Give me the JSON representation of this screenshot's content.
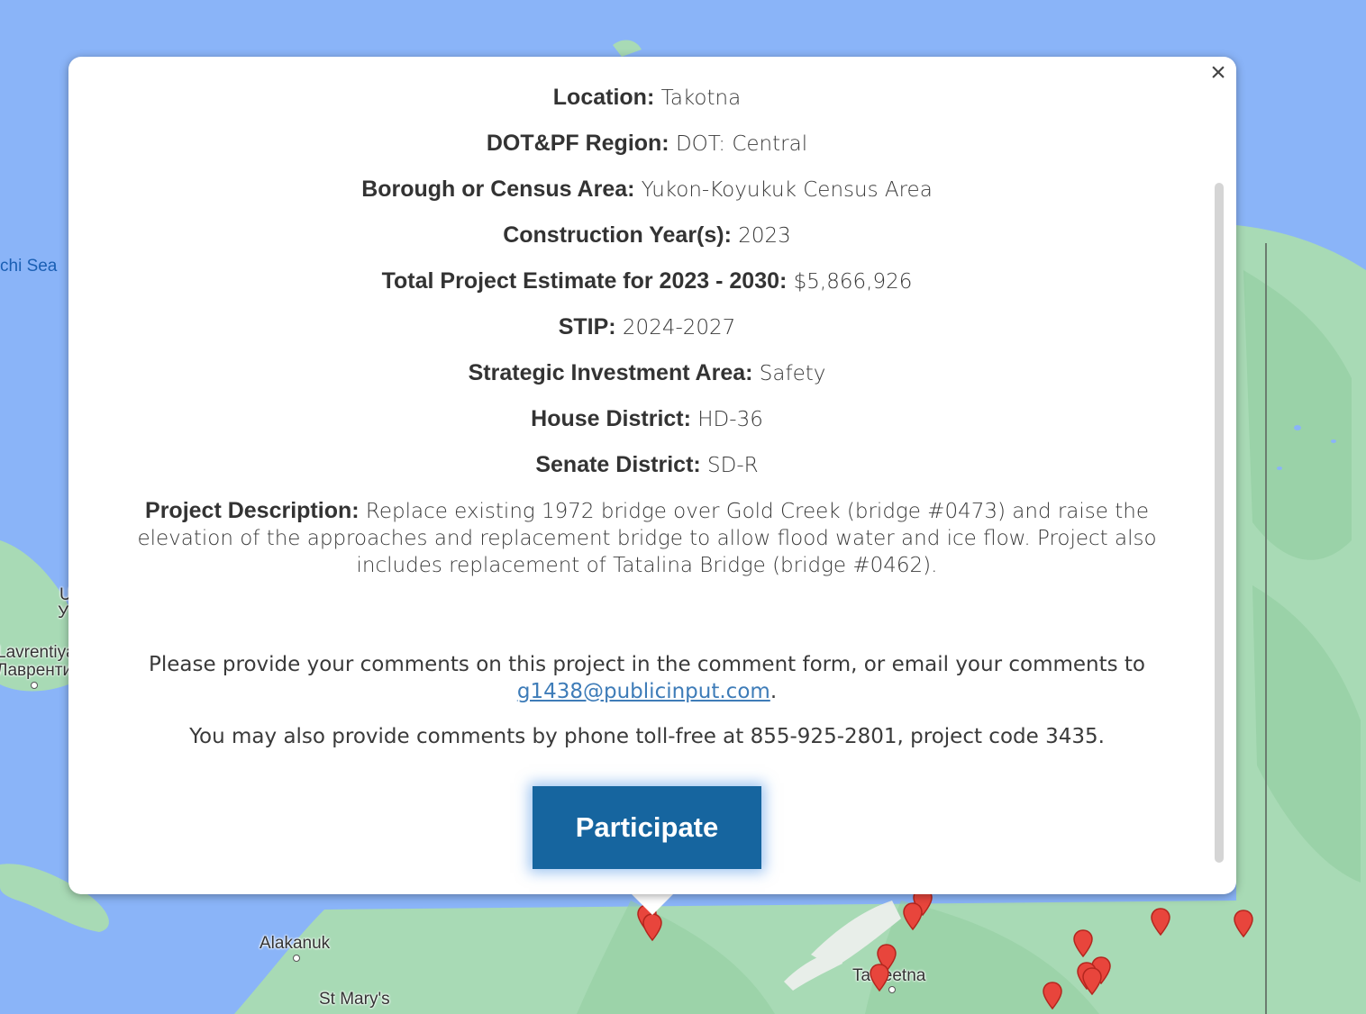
{
  "map": {
    "labels": {
      "sea": "chi Sea",
      "lavrentiya": "Lavrentiya",
      "lavrentiya_cyr": "Лаврентия",
      "partial_u": "U",
      "partial_y": "У",
      "alakanuk": "Alakanuk",
      "st_marys": "St Mary's",
      "talkeetna": "Talkeetna"
    },
    "colors": {
      "water": "#8ab4f8",
      "land": "#a8dab5",
      "pin": "#e8453c"
    }
  },
  "popup": {
    "close_icon": "×",
    "fields": [
      {
        "label": "Location:",
        "value": "Takotna"
      },
      {
        "label": "DOT&PF Region:",
        "value": "DOT: Central"
      },
      {
        "label": "Borough or Census Area:",
        "value": "Yukon-Koyukuk Census Area"
      },
      {
        "label": "Construction Year(s):",
        "value": "2023"
      },
      {
        "label": "Total Project Estimate for 2023 - 2030:",
        "value": "$5,866,926"
      },
      {
        "label": "STIP:",
        "value": "2024-2027"
      },
      {
        "label": "Strategic Investment Area:",
        "value": "Safety"
      },
      {
        "label": "House District:",
        "value": "HD-36"
      },
      {
        "label": "Senate District:",
        "value": "SD-R"
      }
    ],
    "description": {
      "label": "Project Description:",
      "value": "Replace existing 1972 bridge over Gold Creek (bridge #0473) and raise the elevation of the approaches and replacement bridge to allow flood water and ice flow. Project also includes replacement of Tatalina Bridge (bridge #0462)."
    },
    "comment_text": "Please provide your comments on this project in the comment form, or email your comments to",
    "email": "g1438@publicinput.com",
    "comment_period": ".",
    "phone_text": "You may also provide comments by phone toll-free at 855-925-2801, project code 3435.",
    "participate_label": "Participate",
    "colors": {
      "button": "#16659f",
      "link": "#3e7cb8"
    }
  }
}
